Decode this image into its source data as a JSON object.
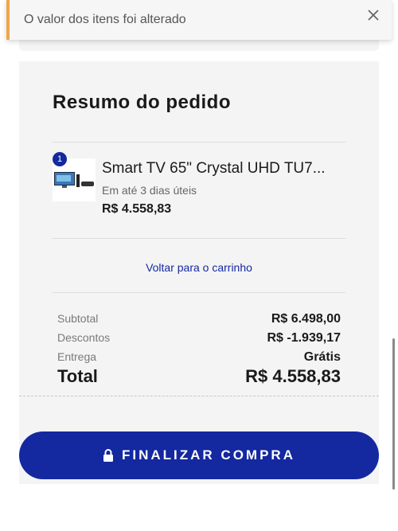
{
  "toast": {
    "message": "O valor dos itens foi alterado",
    "close_icon": "close-icon"
  },
  "summary": {
    "title": "Resumo do pedido",
    "item": {
      "quantity": "1",
      "name": "Smart TV 65\" Crystal UHD TU7...",
      "delivery": "Em até 3 dias úteis",
      "price": "R$ 4.558,83",
      "image_icon": "tv-product-image"
    },
    "back_link": "Voltar para o carrinho",
    "rows": {
      "subtotal_label": "Subtotal",
      "subtotal_value": "R$ 6.498,00",
      "discount_label": "Descontos",
      "discount_value": "R$ -1.939,17",
      "delivery_label": "Entrega",
      "delivery_value": "Grátis",
      "total_label": "Total",
      "total_value": "R$ 4.558,83"
    }
  },
  "checkout": {
    "label": "FINALIZAR COMPRA",
    "icon": "lock-icon"
  },
  "colors": {
    "brand": "#1428a0",
    "toast_accent": "#f0a54a",
    "card_bg": "#f4f4f4"
  }
}
